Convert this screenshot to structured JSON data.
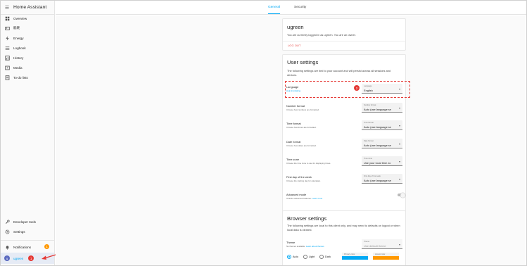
{
  "app": {
    "title": "Home Assistant"
  },
  "colors": {
    "accent": "#03a9f4",
    "primary": "#03a9f4",
    "secondary": "#ff9800",
    "alert": "#e53935"
  },
  "sidebar": {
    "items": [
      {
        "label": "Overview",
        "icon": "grid-icon"
      },
      {
        "label": "能耗",
        "icon": "card-icon"
      },
      {
        "label": "Energy",
        "icon": "lightning-icon"
      },
      {
        "label": "Logbook",
        "icon": "list-icon"
      },
      {
        "label": "History",
        "icon": "chart-icon"
      },
      {
        "label": "Media",
        "icon": "media-icon"
      },
      {
        "label": "To-do lists",
        "icon": "checklist-icon"
      }
    ],
    "bottom": [
      {
        "label": "Developer tools",
        "icon": "wrench-icon"
      },
      {
        "label": "Settings",
        "icon": "gear-icon"
      }
    ],
    "notifications": {
      "label": "Notifications",
      "count": "1"
    },
    "user": {
      "name": "ugreen",
      "initial": "u",
      "marker": "1"
    }
  },
  "tabs": [
    {
      "label": "General",
      "active": true
    },
    {
      "label": "Security",
      "active": false
    }
  ],
  "account": {
    "name": "ugreen",
    "message": "You are currently logged in as ugreen. You are an owner.",
    "logout": "LOG OUT"
  },
  "user_settings": {
    "title": "User settings",
    "description": "The following settings are tied to your account and will persist across all sessions and devices.",
    "language": {
      "label": "Language",
      "link": "Help translating",
      "caption": "Language",
      "value": "English",
      "marker": "2"
    },
    "rows": [
      {
        "label": "Number format",
        "sub": "Choose how numbers are formatted.",
        "caption": "Number format",
        "value": "Auto (use language se"
      },
      {
        "label": "Time format",
        "sub": "Choose how times are formatted.",
        "caption": "Time format",
        "value": "Auto (use language se"
      },
      {
        "label": "Date format",
        "sub": "Choose how dates are formatted.",
        "caption": "Date format",
        "value": "Auto (use language se"
      },
      {
        "label": "Time zone",
        "sub": "Choose the time zone to use for displaying times.",
        "caption": "Time zone",
        "value": "Use your local time zo"
      },
      {
        "label": "First day of the week",
        "sub": "Choose the starting day for calendars.",
        "caption": "First day of the week",
        "value": "Auto (use language se"
      }
    ],
    "advanced": {
      "label": "Advanced mode",
      "sub": "Unlocks advanced features.",
      "link": "Learn more",
      "enabled": false
    }
  },
  "browser_settings": {
    "title": "Browser settings",
    "description": "The following settings are local to this client only, and may need to defaults on logout or when local data is cleared.",
    "theme": {
      "label": "Theme",
      "sub": "No themes available.",
      "link": "Learn about themes",
      "caption": "Theme",
      "value": "Use default theme"
    },
    "modes": [
      {
        "label": "Auto",
        "checked": true
      },
      {
        "label": "Light",
        "checked": false
      },
      {
        "label": "Dark",
        "checked": false
      }
    ],
    "primary_color_label": "Primary color",
    "accent_color_label": "Accent color"
  }
}
